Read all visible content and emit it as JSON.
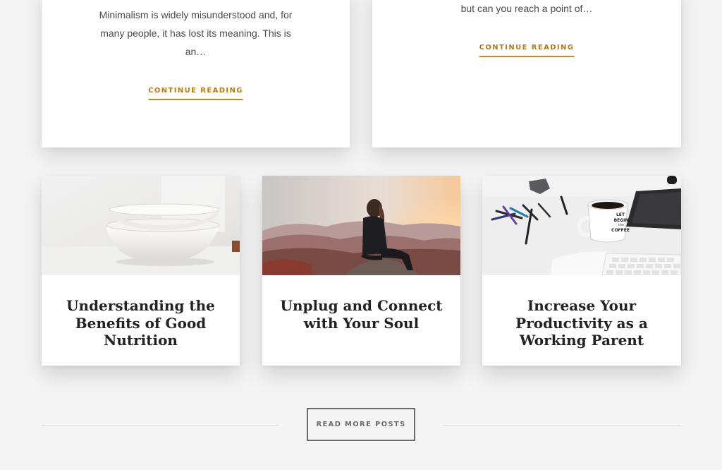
{
  "top_cards": [
    {
      "excerpt": "Minimalism is widely misunderstood and, for many people, it has lost its meaning. This is an…",
      "cta": "CONTINUE READING"
    },
    {
      "excerpt": "but can you reach a point of…",
      "cta": "CONTINUE READING"
    }
  ],
  "posts": [
    {
      "title": "Understanding the Benefits of Good Nutrition",
      "image": "white-bowls-photo"
    },
    {
      "title": "Unplug and Connect with Your Soul",
      "image": "mountain-sunset-photo"
    },
    {
      "title": "Increase Your Productivity as a Working Parent",
      "image": "desk-coffee-mug-photo"
    }
  ],
  "mug_text": [
    "LET",
    "BEGIN",
    "the",
    "COFFEE"
  ],
  "read_more_label": "READ MORE POSTS",
  "colors": {
    "background": "#f4f4f4",
    "accent": "#b87a10",
    "title": "#222222",
    "button_border": "#6b6b6b"
  }
}
